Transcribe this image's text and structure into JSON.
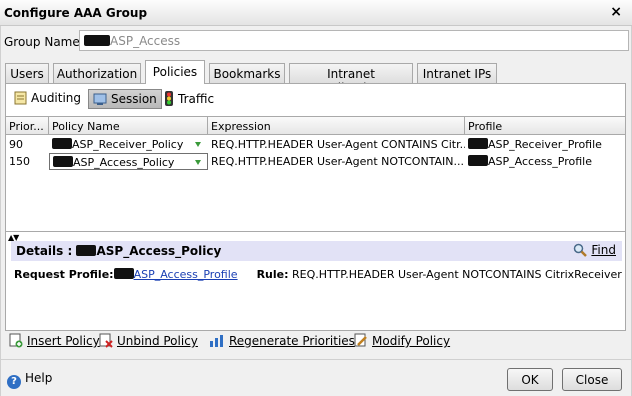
{
  "window": {
    "title": "Configure AAA Group",
    "close_glyph": "×"
  },
  "group_name": {
    "label": "Group Name*",
    "value_suffix": "ASP_Access"
  },
  "tabs": [
    {
      "label": "Users"
    },
    {
      "label": "Authorization"
    },
    {
      "label": "Policies",
      "active": true
    },
    {
      "label": "Bookmarks"
    },
    {
      "label": "Intranet Applications"
    },
    {
      "label": "Intranet IPs"
    }
  ],
  "subtabs": [
    {
      "label": "Auditing",
      "icon": "note-icon"
    },
    {
      "label": "Session",
      "icon": "session-icon",
      "active": true
    },
    {
      "label": "Traffic",
      "icon": "traffic-light-icon"
    }
  ],
  "grid": {
    "columns": [
      "Prior...",
      "Policy Name",
      "Expression",
      "Profile"
    ],
    "rows": [
      {
        "priority": "90",
        "policy_suffix": "ASP_Receiver_Policy",
        "expression": "REQ.HTTP.HEADER User-Agent CONTAINS Citr...",
        "profile_suffix": "ASP_Receiver_Profile"
      },
      {
        "priority": "150",
        "policy_suffix": "ASP_Access_Policy",
        "expression": "REQ.HTTP.HEADER User-Agent NOTCONTAIN...",
        "profile_suffix": "ASP_Access_Profile"
      }
    ]
  },
  "splitter": {
    "glyph": "▲▼"
  },
  "details": {
    "prefix": "Details :",
    "policy_suffix": "ASP_Access_Policy",
    "find_label": "Find",
    "request_profile_label": "Request Profile:",
    "request_profile_suffix": "ASP_Access_Profile",
    "rule_label": "Rule:",
    "rule_value": "REQ.HTTP.HEADER User-Agent NOTCONTAINS CitrixReceiver"
  },
  "actions": [
    {
      "label": "Insert Policy",
      "icon": "insert-policy-icon"
    },
    {
      "label": "Unbind Policy",
      "icon": "unbind-policy-icon"
    },
    {
      "label": "Regenerate Priorities",
      "icon": "regenerate-icon"
    },
    {
      "label": "Modify Policy",
      "icon": "modify-policy-icon"
    }
  ],
  "footer": {
    "help_label": "Help",
    "ok_label": "OK",
    "close_label": "Close"
  },
  "colors": {
    "details_bar": "#e2e2f6",
    "link": "#1a3fb3",
    "dropdown_arrow": "#3a9a3a"
  }
}
